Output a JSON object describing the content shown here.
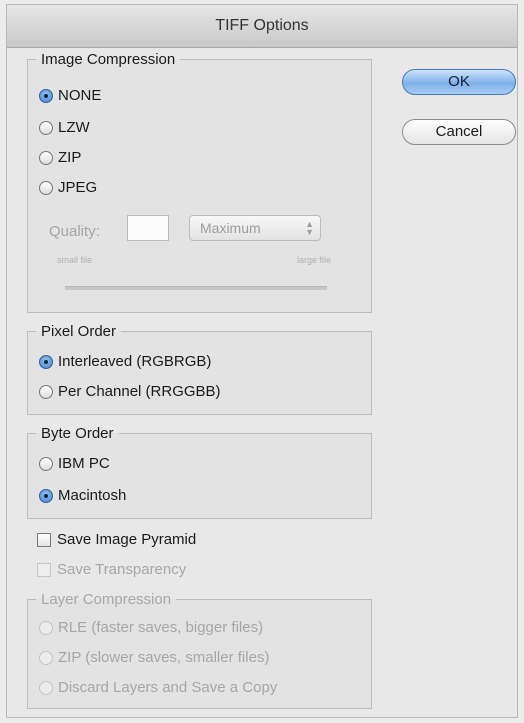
{
  "dialog": {
    "title": "TIFF Options"
  },
  "buttons": {
    "ok": "OK",
    "cancel": "Cancel"
  },
  "image_compression": {
    "legend": "Image Compression",
    "options": [
      {
        "label": "NONE",
        "selected": true
      },
      {
        "label": "LZW",
        "selected": false
      },
      {
        "label": "ZIP",
        "selected": false
      },
      {
        "label": "JPEG",
        "selected": false
      }
    ],
    "quality_label": "Quality:",
    "quality_value": "",
    "quality_preset": "Maximum",
    "small_file": "small file",
    "large_file": "large file"
  },
  "pixel_order": {
    "legend": "Pixel Order",
    "options": [
      {
        "label": "Interleaved (RGBRGB)",
        "selected": true
      },
      {
        "label": "Per Channel (RRGGBB)",
        "selected": false
      }
    ]
  },
  "byte_order": {
    "legend": "Byte Order",
    "options": [
      {
        "label": "IBM PC",
        "selected": false
      },
      {
        "label": "Macintosh",
        "selected": true
      }
    ]
  },
  "checkboxes": {
    "save_image_pyramid": "Save Image Pyramid",
    "save_transparency": "Save Transparency"
  },
  "layer_compression": {
    "legend": "Layer Compression",
    "options": [
      {
        "label": "RLE (faster saves, bigger files)"
      },
      {
        "label": "ZIP (slower saves, smaller files)"
      },
      {
        "label": "Discard Layers and Save a Copy"
      }
    ]
  },
  "colors": {
    "accent": "#5a8fd8",
    "disabled_text": "#a6a6a6"
  }
}
